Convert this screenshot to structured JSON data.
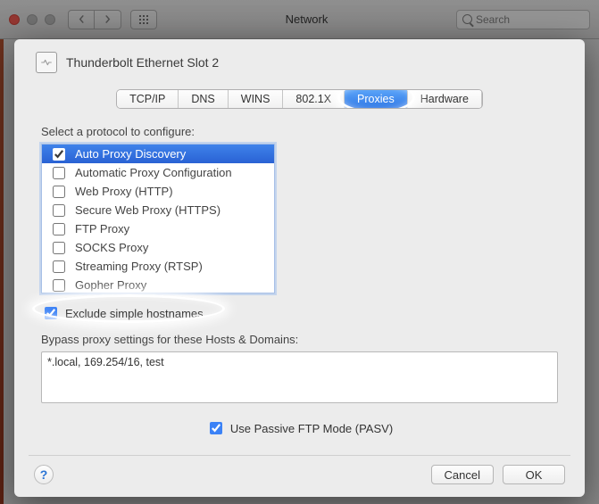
{
  "window": {
    "title": "Network",
    "search_placeholder": "Search"
  },
  "sheet": {
    "interface_name": "Thunderbolt Ethernet Slot 2",
    "tabs": [
      "TCP/IP",
      "DNS",
      "WINS",
      "802.1X",
      "Proxies",
      "Hardware"
    ],
    "active_tab": "Proxies",
    "select_protocol_label": "Select a protocol to configure:",
    "protocols": [
      {
        "label": "Auto Proxy Discovery",
        "checked": true,
        "selected": true
      },
      {
        "label": "Automatic Proxy Configuration",
        "checked": false,
        "selected": false
      },
      {
        "label": "Web Proxy (HTTP)",
        "checked": false,
        "selected": false
      },
      {
        "label": "Secure Web Proxy (HTTPS)",
        "checked": false,
        "selected": false
      },
      {
        "label": "FTP Proxy",
        "checked": false,
        "selected": false
      },
      {
        "label": "SOCKS Proxy",
        "checked": false,
        "selected": false
      },
      {
        "label": "Streaming Proxy (RTSP)",
        "checked": false,
        "selected": false
      },
      {
        "label": "Gopher Proxy",
        "checked": false,
        "selected": false
      }
    ],
    "exclude_simple_hostnames": {
      "label": "Exclude simple hostnames",
      "checked": true
    },
    "bypass_label": "Bypass proxy settings for these Hosts & Domains:",
    "bypass_value": "*.local, 169.254/16, test",
    "use_passive_ftp": {
      "label": "Use Passive FTP Mode (PASV)",
      "checked": true
    },
    "footer": {
      "help": "?",
      "cancel": "Cancel",
      "ok": "OK"
    }
  }
}
